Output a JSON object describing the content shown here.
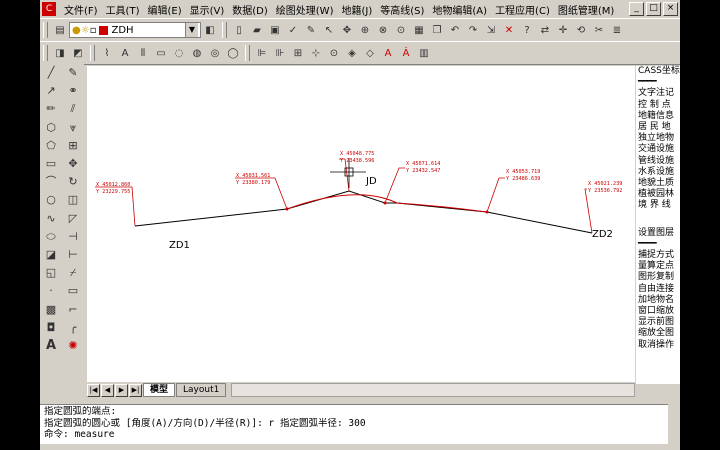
{
  "menubar": {
    "items": [
      "文件(F)",
      "工具(T)",
      "编辑(E)",
      "显示(V)",
      "数据(D)",
      "绘图处理(W)",
      "地籍(J)",
      "等高线(S)",
      "地物编辑(A)",
      "工程应用(C)",
      "图纸管理(M)"
    ],
    "window_buttons": [
      "_",
      "□",
      "×"
    ]
  },
  "toolbar1": {
    "layer_name": "ZDH"
  },
  "canvas": {
    "point_labels": {
      "zd1": "ZD1",
      "zd2": "ZD2",
      "jd": "JD"
    },
    "coord_labels": [
      {
        "x": "X 45012.860",
        "y": "Y 23229.755"
      },
      {
        "x": "X 45031.561",
        "y": "Y 23380.179"
      },
      {
        "x": "X 45048.775",
        "y": "Y 23438.596"
      },
      {
        "x": "X 45071.614",
        "y": "Y 23432.547"
      },
      {
        "x": "X 45053.719",
        "y": "Y 23486.639"
      },
      {
        "x": "X 45021.239",
        "y": "Y 23536.792"
      }
    ]
  },
  "right_menu": {
    "title": "CASS坐标",
    "separator": "━━━━",
    "items1": [
      "文字注记",
      "控 制 点",
      "地籍信息",
      "居 民 地",
      "独立地物",
      "交通设施",
      "管线设施",
      "水系设施",
      "地貌土质",
      "植被园林",
      "境 界 线"
    ],
    "items2": [
      "设置图层",
      "━━━━",
      "捕捉方式",
      "量算定点",
      "图形复制",
      "自由连接",
      "加地物名",
      "窗口缩放",
      "显示前图",
      "缩放全图",
      "取消操作"
    ]
  },
  "tabs": {
    "nav": [
      "|◀",
      "◀",
      "▶",
      "▶|"
    ],
    "model": "模型",
    "layout": "Layout1"
  },
  "command": {
    "line1": "指定圆弧的端点:",
    "line2": "指定圆弧的圆心或 [角度(A)/方向(D)/半径(R)]: r 指定圆弧半径: 300",
    "line3": "命令: measure"
  },
  "colors": {
    "accent_red": "#cc0000",
    "polyline": "#000000"
  }
}
